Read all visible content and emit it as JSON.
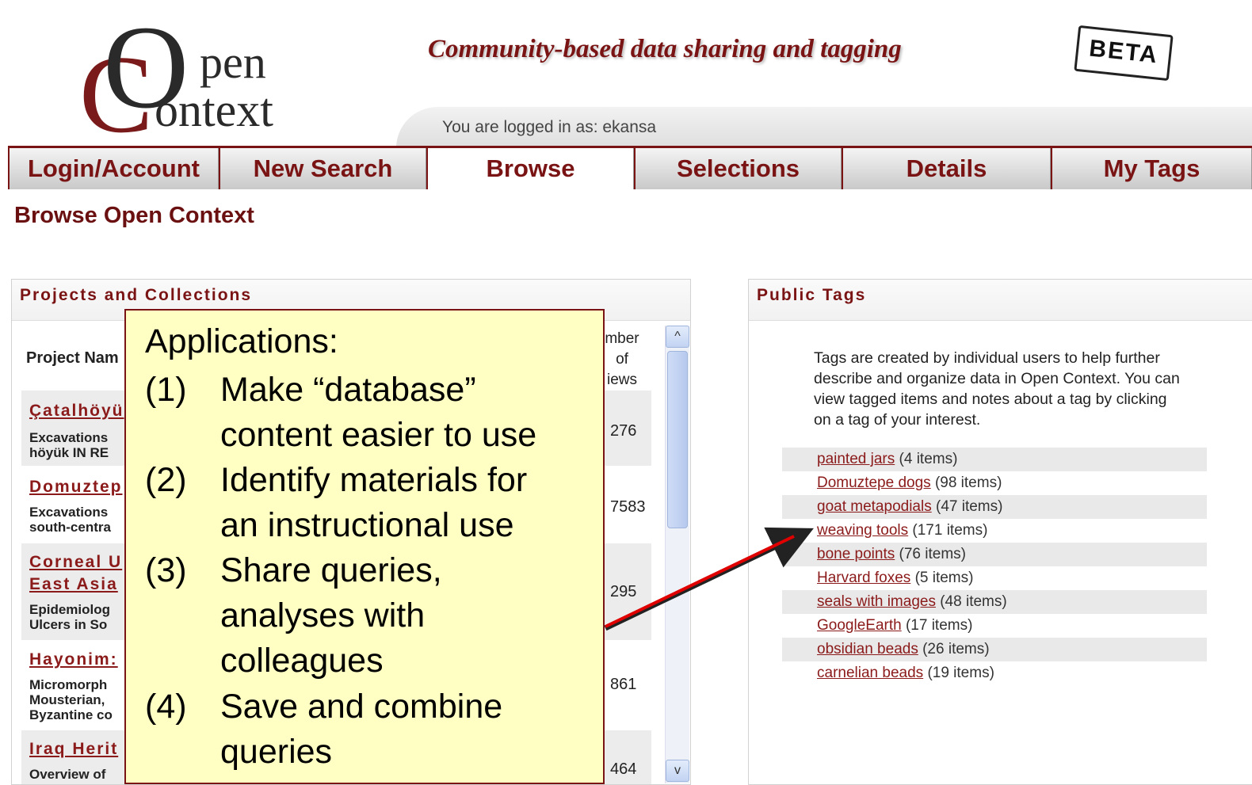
{
  "logo": {
    "letter_o": "O",
    "letter_c": "C",
    "pen": "pen",
    "ontext": "ontext"
  },
  "tagline": "Community-based data sharing and tagging",
  "beta": "BETA",
  "login_status": "You are logged in as: ekansa",
  "tabs": [
    {
      "label": "Login/Account"
    },
    {
      "label": "New Search"
    },
    {
      "label": "Browse"
    },
    {
      "label": "Selections"
    },
    {
      "label": "Details"
    },
    {
      "label": "My Tags"
    }
  ],
  "page_title": "Browse Open Context",
  "projects": {
    "heading": "Projects and Collections",
    "col_name": "Project Nam",
    "col_count_lines": [
      "mber",
      "of",
      "iews"
    ],
    "rows": [
      {
        "name": "Çatalhöyü",
        "desc": [
          "Excavations",
          "höyük IN RE"
        ],
        "count": "276"
      },
      {
        "name": "Domuztep",
        "desc": [
          "Excavations",
          "south-centra"
        ],
        "count": "7583"
      },
      {
        "name": "Corneal U",
        "name2": "East Asia",
        "desc": [
          "Epidemiolog",
          "Ulcers in So"
        ],
        "count": "295"
      },
      {
        "name": "Hayonim:",
        "desc": [
          "Micromorph",
          "Mousterian,",
          "Byzantine co"
        ],
        "count": "861"
      },
      {
        "name": "Iraq Herit",
        "desc": [
          "Overview of"
        ],
        "count": "464"
      }
    ],
    "scroll_up": "^",
    "scroll_down": "v"
  },
  "tags": {
    "heading": "Public Tags",
    "intro": "Tags are created by individual users to help further describe and organize data in Open Context. You can view tagged items and notes about a tag by clicking on a tag of your interest.",
    "items": [
      {
        "name": "painted jars",
        "count": "(4 items)"
      },
      {
        "name": "Domuztepe dogs",
        "count": "(98 items)"
      },
      {
        "name": "goat metapodials",
        "count": "(47 items)"
      },
      {
        "name": "weaving tools",
        "count": "(171 items)"
      },
      {
        "name": "bone points",
        "count": "(76 items)"
      },
      {
        "name": "Harvard foxes",
        "count": "(5 items)"
      },
      {
        "name": "seals with images",
        "count": "(48 items)"
      },
      {
        "name": "GoogleEarth",
        "count": "(17 items)"
      },
      {
        "name": "obsidian beads",
        "count": "(26 items)"
      },
      {
        "name": "carnelian beads",
        "count": "(19 items)"
      }
    ]
  },
  "callout": {
    "title": "Applications:",
    "items": [
      {
        "num": "(1)",
        "lines": [
          "Make “database”",
          "content easier to use"
        ]
      },
      {
        "num": "(2)",
        "lines": [
          "Identify materials for",
          "an instructional use"
        ]
      },
      {
        "num": "(3)",
        "lines": [
          "Share queries,",
          "analyses with",
          "colleagues"
        ]
      },
      {
        "num": "(4)",
        "lines": [
          "Save and combine",
          "queries"
        ]
      }
    ]
  },
  "colors": {
    "accent": "#7a1414",
    "callout_bg": "#ffffc4",
    "arrow": "#e00000"
  }
}
